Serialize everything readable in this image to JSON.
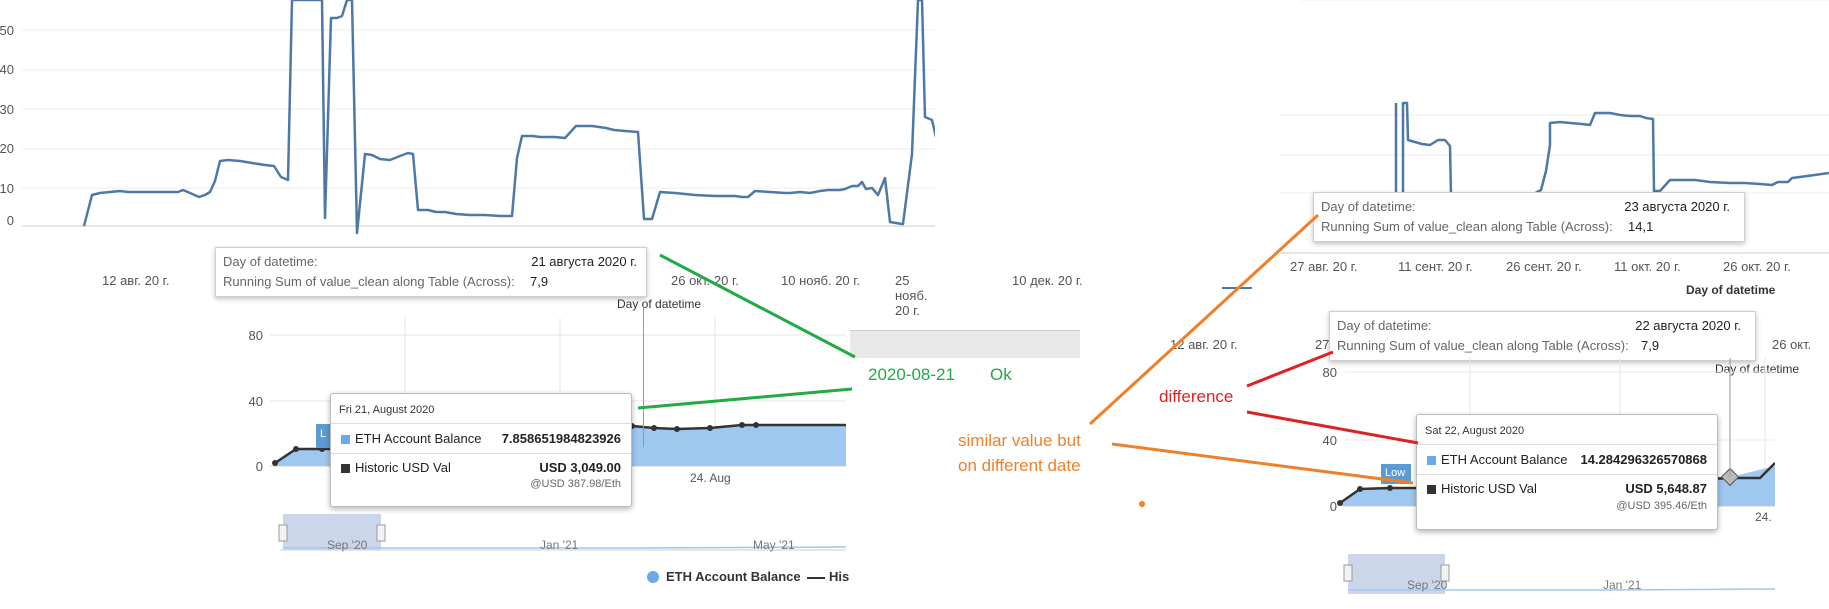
{
  "left_tableau": {
    "y_ticks": [
      "50",
      "40",
      "30",
      "20",
      "10",
      "0"
    ],
    "x_ticks": [
      "12 авг. 20 г.",
      "26 окт. 20 г.",
      "10 нояб. 20 г.",
      "25 нояб. 20 г.",
      "10 дек. 20 г."
    ],
    "axis_title": "Day of datetime",
    "tooltip": {
      "row1_key": "Day of datetime:",
      "row1_val": "21 августа 2020 г.",
      "row2_key": "Running Sum of value_clean along Table (Across):",
      "row2_val": "7,9"
    },
    "line_color": "#4e79a7"
  },
  "left_highcharts": {
    "y_ticks": [
      "80",
      "40",
      "0"
    ],
    "x_tick": "24. Aug",
    "navigator_ticks": [
      "Sep '20",
      "Jan '21",
      "May '21"
    ],
    "legend": {
      "area_label": "ETH Account Balance",
      "line_label": "His"
    },
    "tooltip": {
      "date": "Fri 21, August 2020",
      "row1_label": "ETH Account Balance",
      "row1_value": "7.858651984823926",
      "row2_label": "Historic USD Val",
      "row2_value": "USD 3,049.00",
      "row2_sub": "@USD 387.98/Eth"
    },
    "flag_label": "L",
    "area_color": "#9ec8f0",
    "line_color": "#333333"
  },
  "right_tableau": {
    "x_ticks": [
      "27 авг. 20 г.",
      "11 сент. 20 г.",
      "26 сент. 20 г.",
      "11 окт. 20 г.",
      "26 окт. 20 г."
    ],
    "axis_title": "Day of datetime",
    "tooltip_top": {
      "row1_key": "Day of datetime:",
      "row1_val": "23 августа 2020 г.",
      "row2_key": "Running Sum of value_clean along Table (Across):",
      "row2_val": "14,1"
    },
    "mid_x_ticks": [
      "12 авг. 20 г.",
      "27",
      "26 окт."
    ],
    "axis_title_partial": "Day of datetime",
    "tooltip_mid": {
      "row1_key": "Day of datetime:",
      "row1_val": "22 августа 2020 г.",
      "row2_key": "Running Sum of value_clean along Table (Across):",
      "row2_val": "7,9"
    }
  },
  "right_highcharts": {
    "y_ticks": [
      "80",
      "40",
      "0"
    ],
    "x_tick": "24.",
    "navigator_ticks": [
      "Sep '20",
      "Jan '21"
    ],
    "flag_label": "Low",
    "tooltip": {
      "date": "Sat 22, August 2020",
      "row1_label": "ETH Account Balance",
      "row1_value": "14.284296326570868",
      "row2_label": "Historic USD Val",
      "row2_value": "USD 5,648.87",
      "row2_sub": "@USD 395.46/Eth"
    }
  },
  "annotations": {
    "ok_date": "2020-08-21",
    "ok_word": "Ok",
    "difference": "difference",
    "similar_line1": "similar value but",
    "similar_line2": "on different date",
    "colors": {
      "green": "#22aa44",
      "red": "#dd2222",
      "orange": "#f07f2a"
    }
  }
}
